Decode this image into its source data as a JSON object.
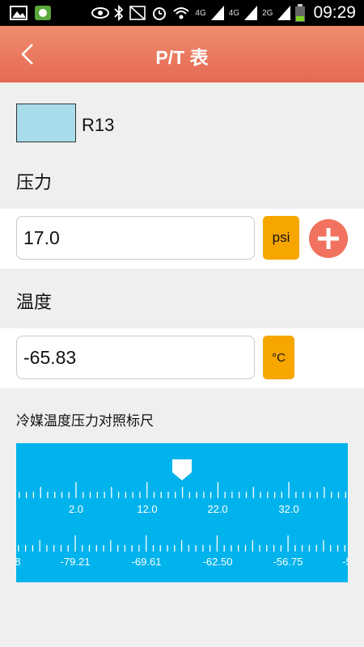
{
  "status_bar": {
    "net_4g_a": "4G",
    "net_4g_b": "4G",
    "net_2g": "2G",
    "time": "09:29",
    "icons": [
      "image-icon",
      "app-icon",
      "eye-icon",
      "bluetooth-icon",
      "nfc-icon",
      "alarm-icon",
      "wifi-icon",
      "signal-icon",
      "battery-icon"
    ]
  },
  "header": {
    "title": "P/T 表",
    "back_icon": "chevron-left-icon"
  },
  "refrigerant": {
    "name": "R13",
    "swatch_color": "#a8dcea"
  },
  "pressure": {
    "label": "压力",
    "value": "17.0",
    "unit": "psi"
  },
  "temperature": {
    "label": "温度",
    "value": "-65.83",
    "unit": "°C"
  },
  "scale": {
    "label": "冷媒温度压力对照标尺",
    "background": "#00b3ec",
    "top_ticks": [
      "2.0",
      "12.0",
      "22.0",
      "32.0"
    ],
    "bottom_ticks": [
      "8",
      "-79.21",
      "-69.61",
      "-62.50",
      "-56.75",
      "-5"
    ]
  },
  "colors": {
    "header": "#e8735a",
    "unit_button": "#f7a600",
    "add_button": "#f1725e"
  }
}
